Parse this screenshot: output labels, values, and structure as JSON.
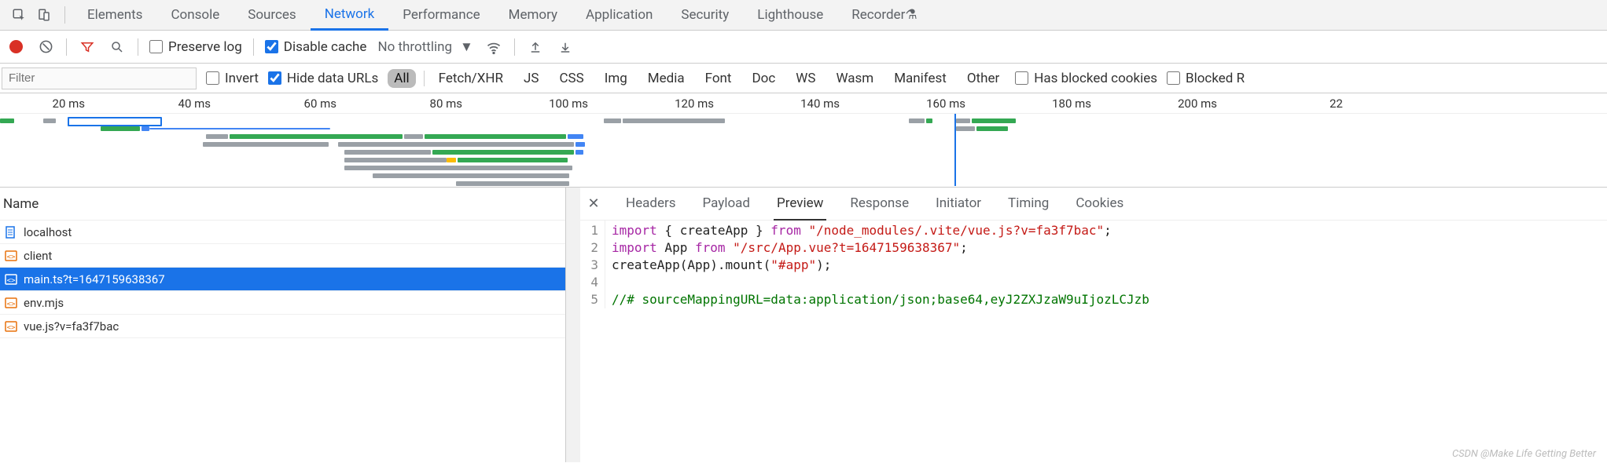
{
  "top_tabs": {
    "items": [
      "Elements",
      "Console",
      "Sources",
      "Network",
      "Performance",
      "Memory",
      "Application",
      "Security",
      "Lighthouse",
      "Recorder"
    ],
    "active_index": 3
  },
  "toolbar": {
    "preserve_log": "Preserve log",
    "disable_cache": "Disable cache",
    "throttling": "No throttling"
  },
  "filterbar": {
    "placeholder": "Filter",
    "invert": "Invert",
    "hide_data_urls": "Hide data URLs",
    "types": [
      "All",
      "Fetch/XHR",
      "JS",
      "CSS",
      "Img",
      "Media",
      "Font",
      "Doc",
      "WS",
      "Wasm",
      "Manifest",
      "Other"
    ],
    "types_active_index": 0,
    "has_blocked_cookies": "Has blocked cookies",
    "blocked_req": "Blocked R"
  },
  "timeline_ticks": [
    "20 ms",
    "40 ms",
    "60 ms",
    "80 ms",
    "100 ms",
    "120 ms",
    "140 ms",
    "160 ms",
    "180 ms",
    "200 ms",
    "22"
  ],
  "requests": {
    "header": "Name",
    "items": [
      {
        "name": "localhost",
        "icon": "doc",
        "selected": false
      },
      {
        "name": "client",
        "icon": "script",
        "selected": false
      },
      {
        "name": "main.ts?t=1647159638367",
        "icon": "script",
        "selected": true
      },
      {
        "name": "env.mjs",
        "icon": "script",
        "selected": false
      },
      {
        "name": "vue.js?v=fa3f7bac",
        "icon": "script",
        "selected": false
      }
    ]
  },
  "detail_tabs": {
    "items": [
      "Headers",
      "Payload",
      "Preview",
      "Response",
      "Initiator",
      "Timing",
      "Cookies"
    ],
    "active_index": 2
  },
  "code": {
    "lines": [
      {
        "n": 1,
        "tokens": [
          [
            "kw",
            "import"
          ],
          [
            "plain",
            " { createApp } "
          ],
          [
            "kw",
            "from"
          ],
          [
            "plain",
            " "
          ],
          [
            "str",
            "\"/node_modules/.vite/vue.js?v=fa3f7bac\""
          ],
          [
            "plain",
            ";"
          ]
        ]
      },
      {
        "n": 2,
        "tokens": [
          [
            "kw",
            "import"
          ],
          [
            "plain",
            " App "
          ],
          [
            "kw",
            "from"
          ],
          [
            "plain",
            " "
          ],
          [
            "str",
            "\"/src/App.vue?t=1647159638367\""
          ],
          [
            "plain",
            ";"
          ]
        ]
      },
      {
        "n": 3,
        "tokens": [
          [
            "plain",
            "createApp(App).mount("
          ],
          [
            "str",
            "\"#app\""
          ],
          [
            "plain",
            ");"
          ]
        ]
      },
      {
        "n": 4,
        "tokens": [
          [
            "plain",
            ""
          ]
        ]
      },
      {
        "n": 5,
        "tokens": [
          [
            "comment",
            "//# sourceMappingURL=data:application/json;base64,eyJ2ZXJzaW9uIjozLCJzb"
          ]
        ]
      }
    ]
  },
  "watermark": "CSDN @Make Life Getting Better"
}
